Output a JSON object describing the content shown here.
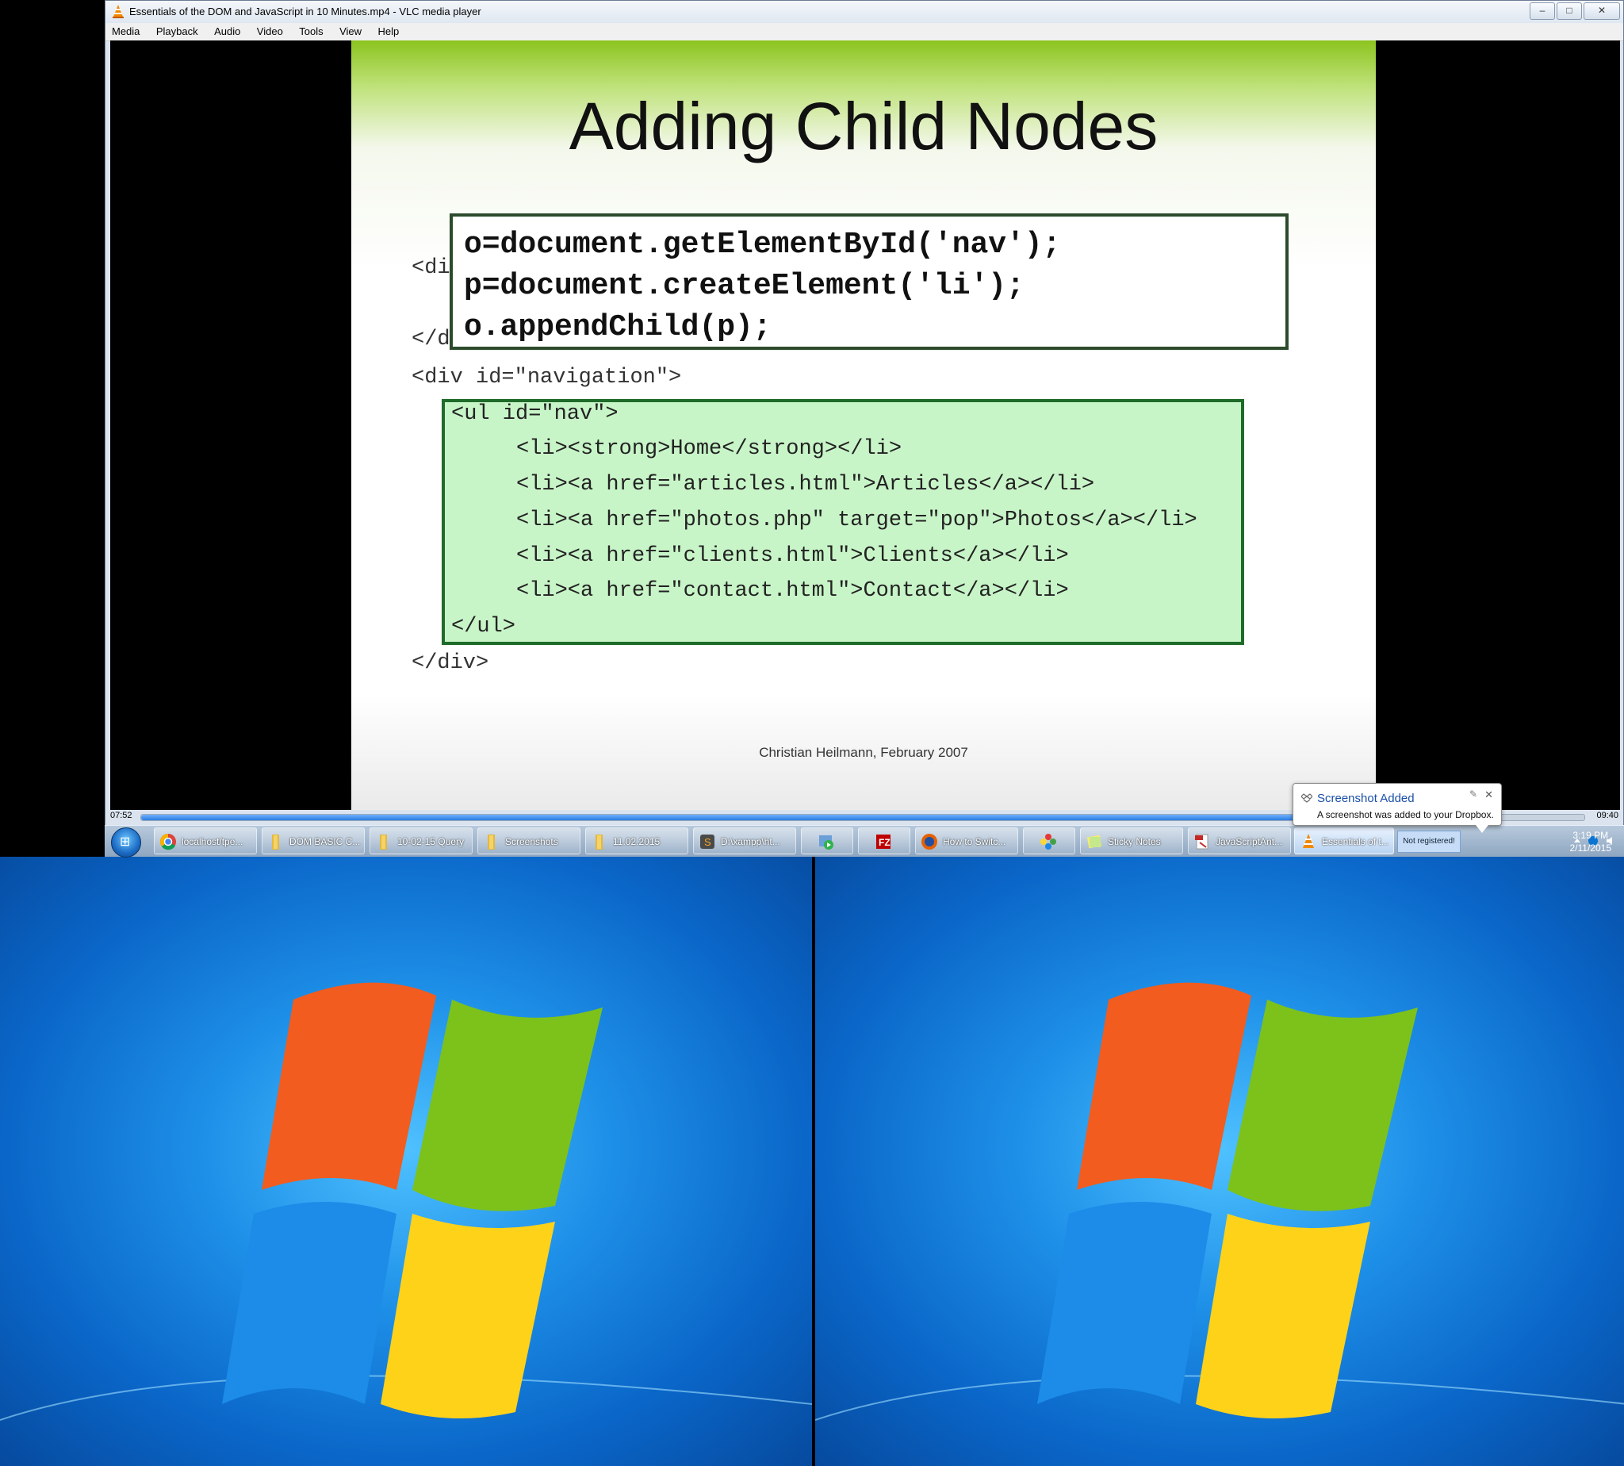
{
  "window": {
    "title": "Essentials of the DOM and JavaScript in 10 Minutes.mp4 - VLC media player",
    "minimize": "–",
    "maximize": "□",
    "close": "✕"
  },
  "menu": [
    "Media",
    "Playback",
    "Audio",
    "Video",
    "Tools",
    "View",
    "Help"
  ],
  "slide": {
    "title": "Adding Child Nodes",
    "code_box": [
      "o=document.getElementById('nav');",
      "p=document.createElement('li');",
      "o.appendChild(p);"
    ],
    "partial_1": "<di",
    "partial_2": "</d",
    "div_open": "<div id=\"navigation\">",
    "list": [
      "<ul id=\"nav\">",
      "<li><strong>Home</strong></li>",
      "<li><a href=\"articles.html\">Articles</a></li>",
      "<li><a href=\"photos.php\" target=\"pop\">Photos</a></li>",
      "<li><a href=\"clients.html\">Clients</a></li>",
      "<li><a href=\"contact.html\">Contact</a></li>",
      "</ul>"
    ],
    "div_close": "</div>",
    "credit": "Christian Heilmann, February 2007"
  },
  "player": {
    "elapsed": "07:52",
    "total": "09:40",
    "progress": 0.81
  },
  "taskbar": {
    "items": [
      {
        "label": "localhost/tpe...",
        "icon": "chrome-icon"
      },
      {
        "label": "DOM BASIC C...",
        "icon": "folder-icon"
      },
      {
        "label": "10-02-15 Query",
        "icon": "folder-icon"
      },
      {
        "label": "Screenshots",
        "icon": "folder-icon"
      },
      {
        "label": "11.02.2015",
        "icon": "folder-icon"
      },
      {
        "label": "D:\\xampp\\ht...",
        "icon": "sublime-icon"
      },
      {
        "label": "",
        "icon": "media-icon"
      },
      {
        "label": "",
        "icon": "filezilla-icon"
      },
      {
        "label": "How to Switc...",
        "icon": "firefox-icon"
      },
      {
        "label": "",
        "icon": "flower-icon"
      },
      {
        "label": "Sticky Notes",
        "icon": "sticky-notes-icon"
      },
      {
        "label": "JavaScriptAnt...",
        "icon": "pdf-icon"
      },
      {
        "label": "Essentials of t...",
        "icon": "vlc-icon"
      }
    ],
    "not_registered": "Not registered!",
    "time": "3:19 PM",
    "date": "2/11/2015"
  },
  "notification": {
    "title": "Screenshot Added",
    "body": "A screenshot was added to your Dropbox."
  },
  "colors": {
    "code_box_border": "#2c4a2c",
    "list_box_fill": "#c8f5c8",
    "list_box_border": "#1f6b2a",
    "slide_green": "#8cc41f",
    "notify_title": "#1a4fa8"
  }
}
